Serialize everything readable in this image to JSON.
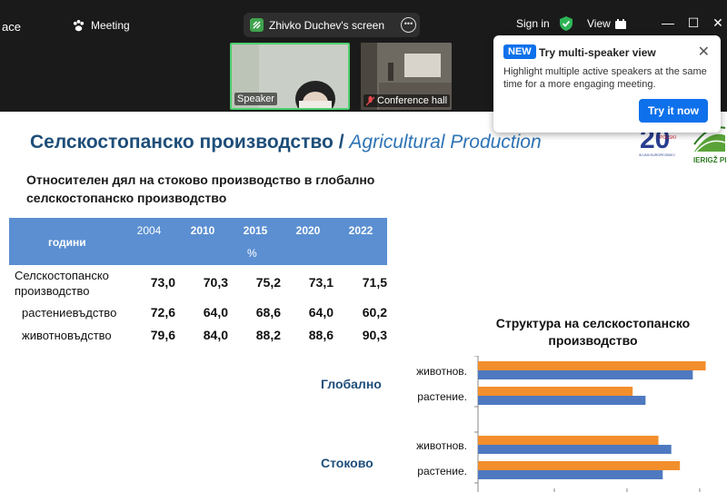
{
  "window": {
    "title_fragment": "ace",
    "meeting_label": "Meeting",
    "screen_share_label": "Zhivko Duchev's screen",
    "sign_in_label": "Sign in",
    "view_label": "View",
    "minimize_glyph": "—",
    "maximize_glyph": "☐",
    "close_glyph": "✕"
  },
  "participants": [
    {
      "name": "Speaker",
      "active": true
    },
    {
      "name": "Conference hall",
      "muted": true
    }
  ],
  "popup": {
    "badge": "NEW",
    "title": "Try multi-speaker view",
    "description": "Highlight multiple active speakers at the same time for a more engaging meeting.",
    "button": "Try it now",
    "close_glyph": "✕"
  },
  "slide": {
    "title_bg": "Селскостопанско производство",
    "title_sep": "/",
    "title_en": "Agricultural Production",
    "subtitle": "Относителен дял на стоково производство в глобално селскостопанско производство",
    "logo_text_1": "LAT",
    "logo_text_2": "POLSKI",
    "logo_text_3": "W UNII EUROPEJSKIEJ",
    "logo_text_4": "IERIGŽ PIB",
    "table": {
      "row_header": "години",
      "unit": "%",
      "years": [
        "2004",
        "2010",
        "2015",
        "2020",
        "2022"
      ],
      "rows": [
        {
          "label": "Селскостопанско производство",
          "values": [
            "73,0",
            "70,3",
            "75,2",
            "73,1",
            "71,5"
          ]
        },
        {
          "label": "растениевъдство",
          "values": [
            "72,6",
            "64,0",
            "68,6",
            "64,0",
            "60,2"
          ]
        },
        {
          "label": "животновъдство",
          "values": [
            "79,6",
            "84,0",
            "88,2",
            "88,6",
            "90,3"
          ]
        }
      ]
    },
    "group_labels": {
      "global": "Глобално",
      "commodity": "Стоково"
    }
  },
  "colors": {
    "orange": "#f28e2c",
    "blue": "#4e79c0",
    "table_header": "#5b8fd1",
    "title_blue": "#1e4e79",
    "accent_blue": "#0e71eb",
    "active_green": "#4ccf6f"
  },
  "chart_data": {
    "type": "bar",
    "orientation": "horizontal",
    "title": "Структура на селскостопанско производство",
    "categories": [
      "животнов.",
      "растение.",
      "животнов.",
      "растение."
    ],
    "groups": [
      "Глобално",
      "Глобално",
      "Стоково",
      "Стоково"
    ],
    "series": [
      {
        "values": [
          53,
          36,
          42,
          47
        ],
        "color": "#f28e2c"
      },
      {
        "values": [
          50,
          39,
          45,
          43
        ],
        "color": "#4e79c0"
      }
    ],
    "xlim": [
      0,
      55
    ],
    "grid": false,
    "legend": "none"
  }
}
